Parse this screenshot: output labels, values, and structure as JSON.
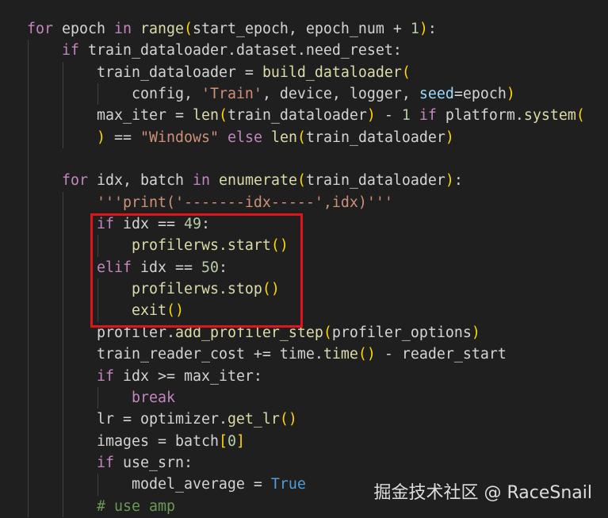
{
  "theme": {
    "background": "#1f1f1f",
    "highlight_box_color": "#e0151b"
  },
  "code": [
    {
      "indent": 0,
      "tokens": [
        [
          "kw",
          "for"
        ],
        [
          "txt",
          " epoch "
        ],
        [
          "kw",
          "in"
        ],
        [
          "txt",
          " "
        ],
        [
          "fn",
          "range"
        ],
        [
          "br",
          "("
        ],
        [
          "txt",
          "start_epoch, epoch_num + "
        ],
        [
          "num",
          "1"
        ],
        [
          "br",
          ")"
        ],
        [
          "txt",
          ":"
        ]
      ]
    },
    {
      "indent": 1,
      "tokens": [
        [
          "kw",
          "if"
        ],
        [
          "txt",
          " train_dataloader.dataset.need_reset:"
        ]
      ]
    },
    {
      "indent": 2,
      "tokens": [
        [
          "txt",
          "train_dataloader = "
        ],
        [
          "fn",
          "build_dataloader"
        ],
        [
          "br",
          "("
        ]
      ]
    },
    {
      "indent": 3,
      "tokens": [
        [
          "txt",
          "config, "
        ],
        [
          "str",
          "'Train'"
        ],
        [
          "txt",
          ", device, logger, "
        ],
        [
          "param",
          "seed"
        ],
        [
          "txt",
          "=epoch"
        ],
        [
          "br",
          ")"
        ]
      ]
    },
    {
      "indent": 2,
      "tokens": [
        [
          "txt",
          "max_iter = "
        ],
        [
          "fn",
          "len"
        ],
        [
          "br",
          "("
        ],
        [
          "txt",
          "train_dataloader"
        ],
        [
          "br",
          ")"
        ],
        [
          "txt",
          " - "
        ],
        [
          "num",
          "1"
        ],
        [
          "txt",
          " "
        ],
        [
          "kw",
          "if"
        ],
        [
          "txt",
          " platform."
        ],
        [
          "fn",
          "system"
        ],
        [
          "br",
          "("
        ]
      ]
    },
    {
      "indent": 2,
      "tokens": [
        [
          "br",
          ")"
        ],
        [
          "txt",
          " == "
        ],
        [
          "str",
          "\"Windows\""
        ],
        [
          "txt",
          " "
        ],
        [
          "kw",
          "else"
        ],
        [
          "txt",
          " "
        ],
        [
          "fn",
          "len"
        ],
        [
          "br",
          "("
        ],
        [
          "txt",
          "train_dataloader"
        ],
        [
          "br",
          ")"
        ]
      ]
    },
    {
      "indent": 1,
      "tokens": []
    },
    {
      "indent": 1,
      "tokens": [
        [
          "kw",
          "for"
        ],
        [
          "txt",
          " idx, batch "
        ],
        [
          "kw",
          "in"
        ],
        [
          "txt",
          " "
        ],
        [
          "fn",
          "enumerate"
        ],
        [
          "br",
          "("
        ],
        [
          "txt",
          "train_dataloader"
        ],
        [
          "br",
          ")"
        ],
        [
          "txt",
          ":"
        ]
      ]
    },
    {
      "indent": 2,
      "tokens": [
        [
          "str",
          "'''print('-------idx-----',idx)'''"
        ]
      ]
    },
    {
      "indent": 2,
      "tokens": [
        [
          "kw",
          "if"
        ],
        [
          "txt",
          " idx == "
        ],
        [
          "num",
          "49"
        ],
        [
          "txt",
          ":"
        ]
      ]
    },
    {
      "indent": 3,
      "tokens": [
        [
          "fn",
          "profilerws.start"
        ],
        [
          "br",
          "()"
        ]
      ]
    },
    {
      "indent": 2,
      "tokens": [
        [
          "kw",
          "elif"
        ],
        [
          "txt",
          " idx == "
        ],
        [
          "num",
          "50"
        ],
        [
          "txt",
          ":"
        ]
      ]
    },
    {
      "indent": 3,
      "tokens": [
        [
          "fn",
          "profilerws.stop"
        ],
        [
          "br",
          "()"
        ]
      ]
    },
    {
      "indent": 3,
      "tokens": [
        [
          "fn",
          "exit"
        ],
        [
          "br",
          "()"
        ]
      ]
    },
    {
      "indent": 2,
      "tokens": [
        [
          "txt",
          "profiler."
        ],
        [
          "fn",
          "add_profiler_step"
        ],
        [
          "br",
          "("
        ],
        [
          "txt",
          "profiler_options"
        ],
        [
          "br",
          ")"
        ]
      ]
    },
    {
      "indent": 2,
      "tokens": [
        [
          "txt",
          "train_reader_cost += time."
        ],
        [
          "fn",
          "time"
        ],
        [
          "br",
          "()"
        ],
        [
          "txt",
          " - reader_start"
        ]
      ]
    },
    {
      "indent": 2,
      "tokens": [
        [
          "kw",
          "if"
        ],
        [
          "txt",
          " idx >= max_iter:"
        ]
      ]
    },
    {
      "indent": 3,
      "tokens": [
        [
          "kw",
          "break"
        ]
      ]
    },
    {
      "indent": 2,
      "tokens": [
        [
          "txt",
          "lr = optimizer."
        ],
        [
          "fn",
          "get_lr"
        ],
        [
          "br",
          "()"
        ]
      ]
    },
    {
      "indent": 2,
      "tokens": [
        [
          "txt",
          "images = batch"
        ],
        [
          "br",
          "["
        ],
        [
          "num",
          "0"
        ],
        [
          "br",
          "]"
        ]
      ]
    },
    {
      "indent": 2,
      "tokens": [
        [
          "kw",
          "if"
        ],
        [
          "txt",
          " use_srn:"
        ]
      ]
    },
    {
      "indent": 3,
      "tokens": [
        [
          "txt",
          "model_average = "
        ],
        [
          "const",
          "True"
        ]
      ]
    },
    {
      "indent": 2,
      "tokens": [
        [
          "com",
          "# use amp"
        ]
      ]
    }
  ],
  "watermark": "掘金技术社区 @ RaceSnail"
}
